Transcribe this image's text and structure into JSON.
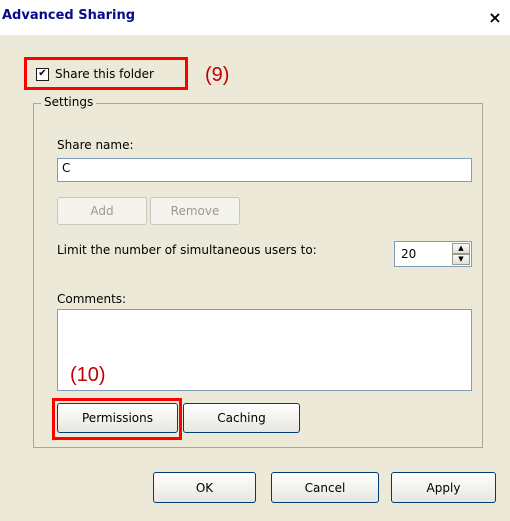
{
  "window": {
    "title": "Advanced Sharing",
    "close_label": "×"
  },
  "share": {
    "checkbox_label": "Share this folder",
    "checked": true,
    "annotation_9": "(9)"
  },
  "settings": {
    "group_label": "Settings",
    "share_name_label": "Share name:",
    "share_name_value": "C",
    "add_label": "Add",
    "remove_label": "Remove",
    "limit_label": "Limit the number of simultaneous users to:",
    "limit_value": "20",
    "comments_label": "Comments:",
    "comments_value": "",
    "annotation_10": "(10)",
    "permissions_label": "Permissions",
    "caching_label": "Caching"
  },
  "footer": {
    "ok_label": "OK",
    "cancel_label": "Cancel",
    "apply_label": "Apply"
  }
}
